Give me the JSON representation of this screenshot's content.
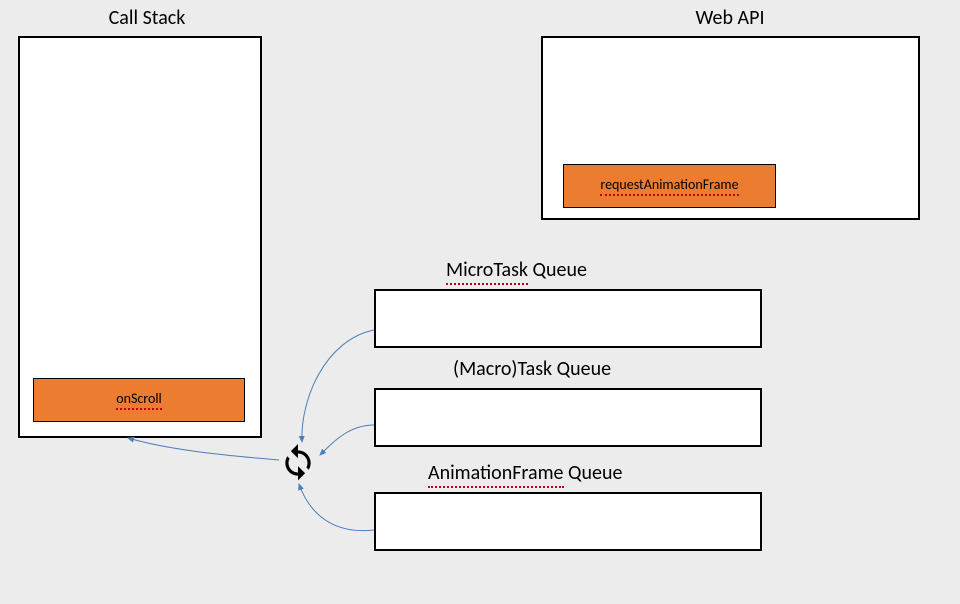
{
  "callStack": {
    "title": "Call Stack",
    "item": "onScroll"
  },
  "webApi": {
    "title": "Web API",
    "item": "requestAnimationFrame"
  },
  "queues": {
    "microtask_prefix": "MicroTask",
    "microtask_suffix": " Queue",
    "macrotask": "(Macro)Task Queue",
    "animationframe_prefix": "AnimationFrame",
    "animationframe_suffix": " Queue"
  }
}
